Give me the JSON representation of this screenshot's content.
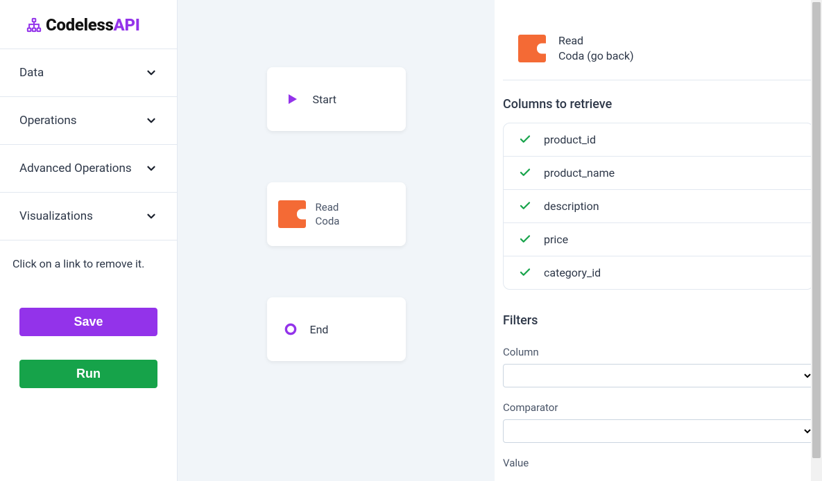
{
  "brand": {
    "name_a": "Codeless",
    "name_b": "API"
  },
  "sidebar": {
    "items": [
      {
        "label": "Data"
      },
      {
        "label": "Operations"
      },
      {
        "label": "Advanced Operations"
      },
      {
        "label": "Visualizations"
      }
    ],
    "hint": "Click on a link to remove it.",
    "save_label": "Save",
    "run_label": "Run"
  },
  "canvas": {
    "nodes": {
      "start": {
        "label": "Start"
      },
      "read": {
        "line1": "Read",
        "line2": "Coda"
      },
      "end": {
        "label": "End"
      }
    }
  },
  "detail": {
    "header_line1": "Read",
    "header_line2_prefix": "Coda ",
    "header_goback": "(go back)",
    "columns_title": "Columns to retrieve",
    "columns": [
      {
        "label": "product_id"
      },
      {
        "label": "product_name"
      },
      {
        "label": "description"
      },
      {
        "label": "price"
      },
      {
        "label": "category_id"
      }
    ],
    "filters_title": "Filters",
    "column_label": "Column",
    "comparator_label": "Comparator",
    "value_label": "Value"
  }
}
